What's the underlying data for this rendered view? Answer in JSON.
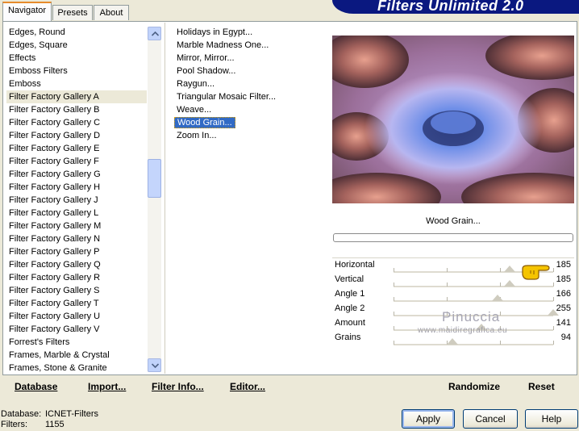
{
  "tabs": [
    "Navigator",
    "Presets",
    "About"
  ],
  "header_title": "Filters Unlimited 2.0",
  "categories": [
    "Edges, Round",
    "Edges, Square",
    "Effects",
    "Emboss Filters",
    "Emboss",
    "Filter Factory Gallery A",
    "Filter Factory Gallery B",
    "Filter Factory Gallery C",
    "Filter Factory Gallery D",
    "Filter Factory Gallery E",
    "Filter Factory Gallery F",
    "Filter Factory Gallery G",
    "Filter Factory Gallery H",
    "Filter Factory Gallery J",
    "Filter Factory Gallery L",
    "Filter Factory Gallery M",
    "Filter Factory Gallery N",
    "Filter Factory Gallery P",
    "Filter Factory Gallery Q",
    "Filter Factory Gallery R",
    "Filter Factory Gallery S",
    "Filter Factory Gallery T",
    "Filter Factory Gallery U",
    "Filter Factory Gallery V",
    "Forrest's Filters",
    "Frames, Marble & Crystal",
    "Frames, Stone & Granite"
  ],
  "selected_category": "Filter Factory Gallery A",
  "filters": [
    "Holidays in Egypt...",
    "Marble Madness One...",
    "Mirror, Mirror...",
    "Pool Shadow...",
    "Raygun...",
    "Triangular Mosaic Filter...",
    "Weave...",
    "Wood Grain...",
    "Zoom In..."
  ],
  "selected_filter": "Wood Grain...",
  "preview_filter_name": "Wood Grain...",
  "params": [
    {
      "name": "Horizontal",
      "value": "185",
      "level": 185
    },
    {
      "name": "Vertical",
      "value": "185",
      "level": 185
    },
    {
      "name": "Angle 1",
      "value": "166",
      "level": 166
    },
    {
      "name": "Angle 2",
      "value": "255",
      "level": 255
    },
    {
      "name": "Amount",
      "value": "141",
      "level": 141
    },
    {
      "name": "Grains",
      "value": "94",
      "level": 94
    }
  ],
  "param_max": 255,
  "watermark": {
    "line1": "Pinuccia",
    "line2": "www.maidiregrafica.eu"
  },
  "bottom_buttons": {
    "database": "Database",
    "import": "Import...",
    "filter_info": "Filter Info...",
    "editor": "Editor...",
    "randomize": "Randomize",
    "reset": "Reset"
  },
  "status": {
    "database_label": "Database:",
    "database_value": "ICNET-Filters",
    "filters_label": "Filters:",
    "filters_value": "1155"
  },
  "dialog_buttons": {
    "apply": "Apply",
    "cancel": "Cancel",
    "help": "Help"
  },
  "colors": {
    "header_bg": "#0a1880",
    "selection_blue": "#316ac5",
    "tab_accent": "#e68b2c"
  },
  "icons": {
    "scroll_up": "chevron-up-icon",
    "scroll_down": "chevron-down-icon",
    "pointer": "pointing-hand-icon"
  }
}
